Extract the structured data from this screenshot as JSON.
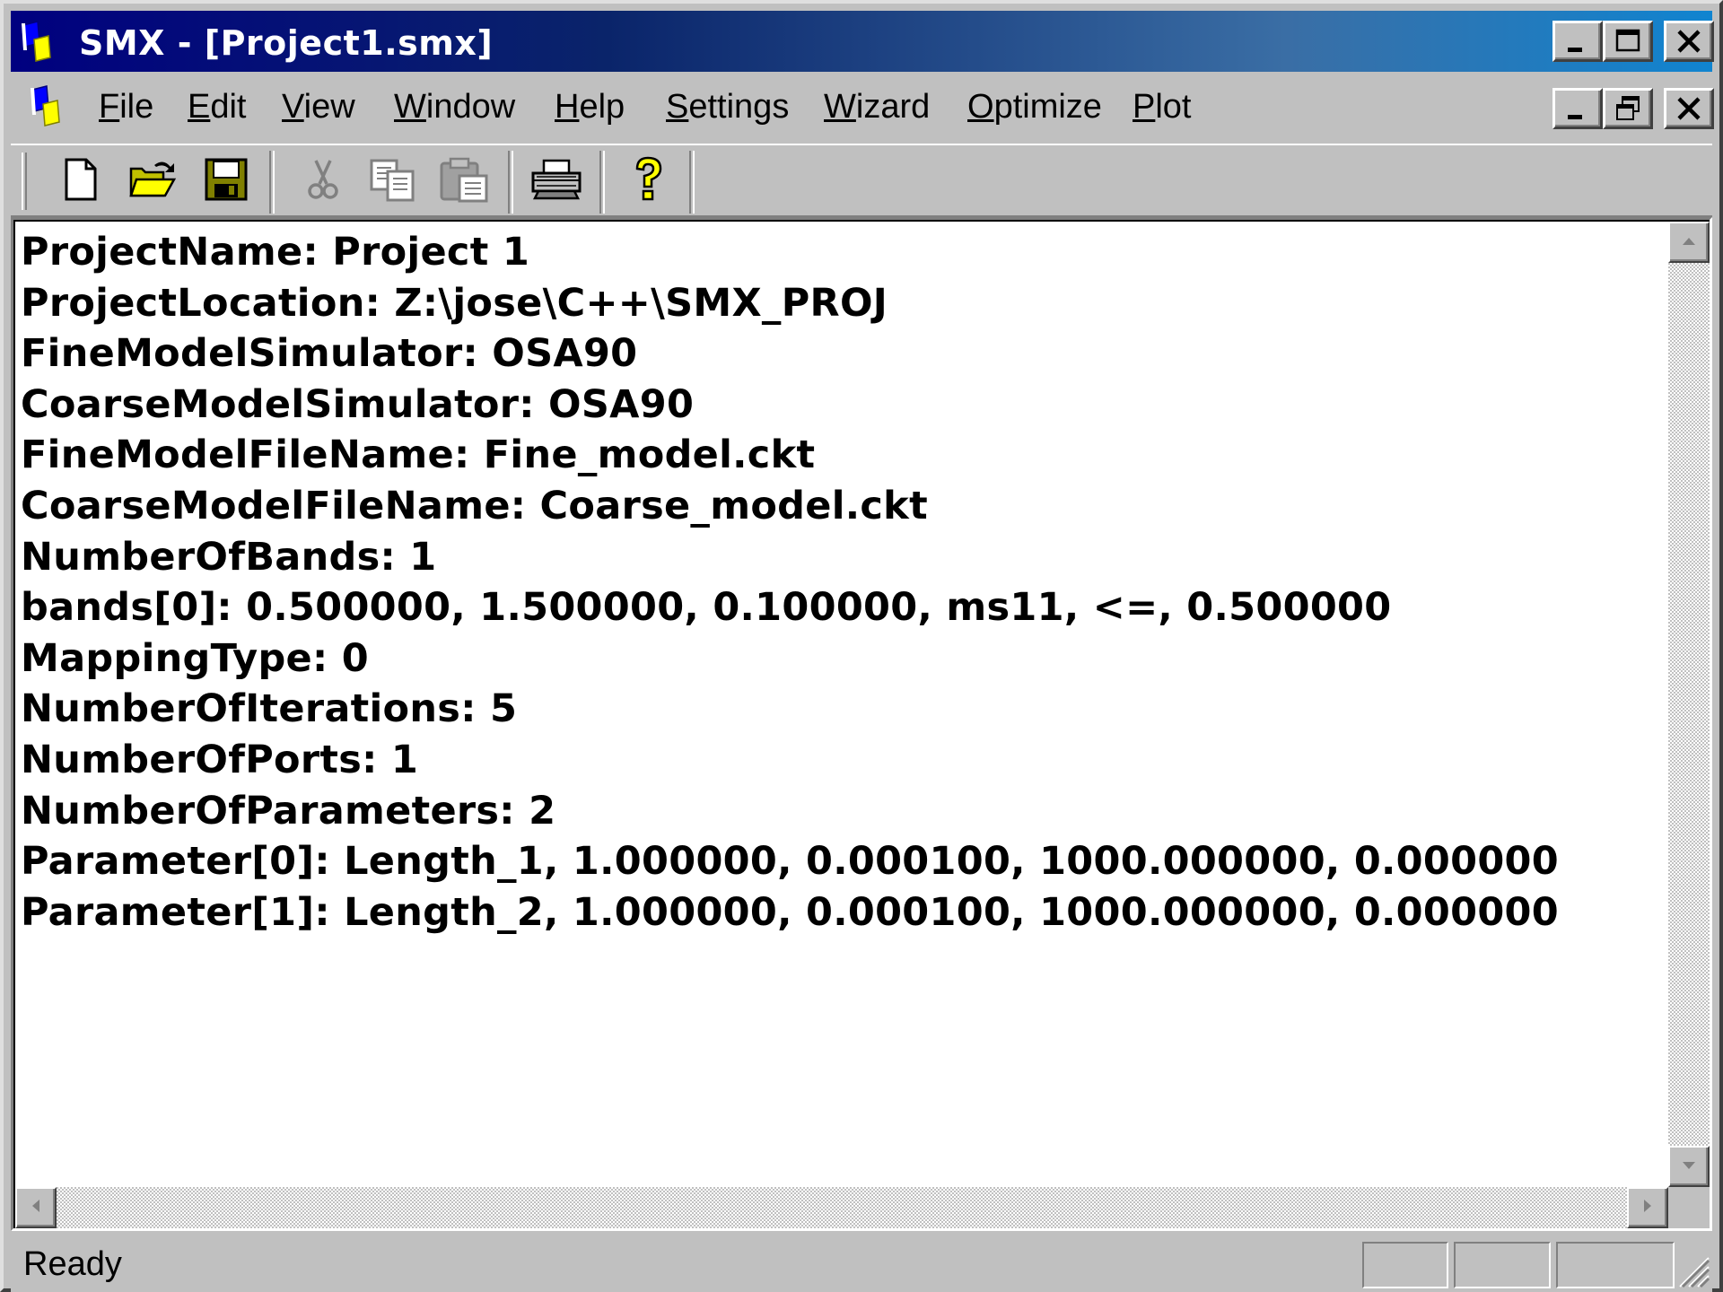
{
  "window": {
    "title": "SMX - [Project1.smx]",
    "icon": "smx-app-icon"
  },
  "menu": {
    "items": [
      {
        "label": "File",
        "key": "F",
        "rest": "ile"
      },
      {
        "label": "Edit",
        "key": "E",
        "rest": "dit"
      },
      {
        "label": "View",
        "key": "V",
        "rest": "iew"
      },
      {
        "label": "Window",
        "key": "W",
        "rest": "indow"
      },
      {
        "label": "Help",
        "key": "H",
        "rest": "elp"
      },
      {
        "label": "Settings",
        "key": "S",
        "rest": "ettings"
      },
      {
        "label": "Wizard",
        "key": "W",
        "rest": "izard"
      },
      {
        "label": "Optimize",
        "key": "O",
        "rest": "ptimize"
      },
      {
        "label": "Plot",
        "key": "P",
        "rest": "lot"
      }
    ]
  },
  "toolbar": {
    "buttons": [
      {
        "name": "new-file-icon",
        "enabled": true
      },
      {
        "name": "open-folder-icon",
        "enabled": true
      },
      {
        "name": "save-disk-icon",
        "enabled": true
      },
      {
        "name": "cut-scissors-icon",
        "enabled": false
      },
      {
        "name": "copy-icon",
        "enabled": false
      },
      {
        "name": "paste-clipboard-icon",
        "enabled": false
      },
      {
        "name": "print-icon",
        "enabled": true
      },
      {
        "name": "help-question-icon",
        "enabled": true
      }
    ]
  },
  "document": {
    "lines": [
      "ProjectName: Project 1",
      "ProjectLocation: Z:\\jose\\C++\\SMX_PROJ",
      "FineModelSimulator: OSA90",
      "CoarseModelSimulator: OSA90",
      "FineModelFileName: Fine_model.ckt",
      "CoarseModelFileName: Coarse_model.ckt",
      "NumberOfBands: 1",
      "bands[0]: 0.500000, 1.500000, 0.100000, ms11, <=, 0.500000",
      "MappingType: 0",
      "NumberOfIterations: 5",
      "NumberOfPorts: 1",
      "NumberOfParameters: 2",
      "Parameter[0]: Length_1, 1.000000, 0.000100, 1000.000000, 0.000000",
      "Parameter[1]: Length_2, 1.000000, 0.000100, 1000.000000, 0.000000"
    ]
  },
  "status": {
    "text": "Ready"
  },
  "colors": {
    "titlebar_start": "#000080",
    "titlebar_end": "#1084d0",
    "face": "#c0c0c0"
  }
}
